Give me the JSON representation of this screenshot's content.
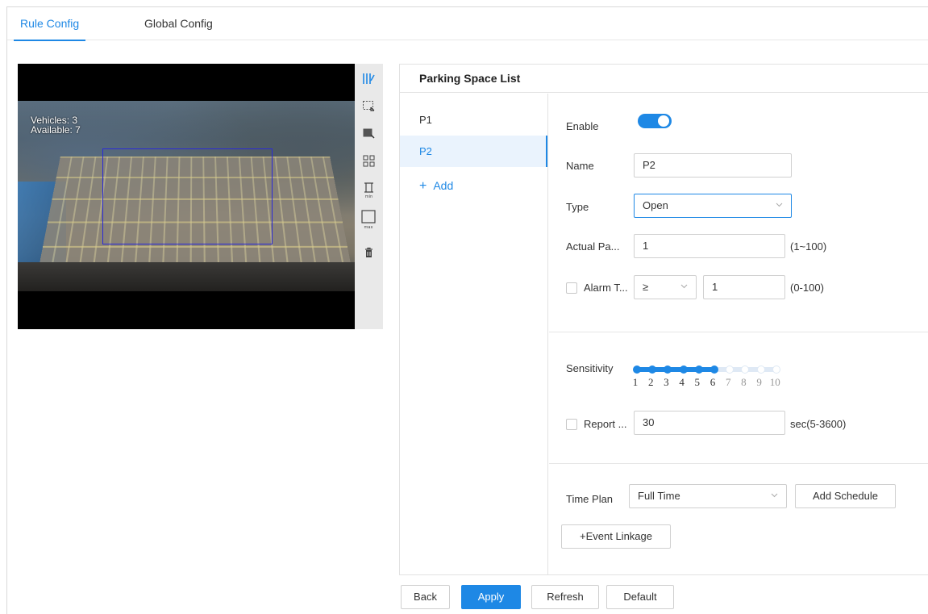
{
  "tabs": [
    {
      "label": "Rule Config",
      "active": true
    },
    {
      "label": "Global Config",
      "active": false
    }
  ],
  "video": {
    "osd_line1": "Vehicles: 3",
    "osd_line2": "Available: 7"
  },
  "toolbar": {
    "tools": [
      "draw-rule-icon",
      "select-area-icon",
      "clear-area-icon",
      "layout-grid-icon",
      "min-size-icon",
      "max-size-icon",
      "delete-icon"
    ],
    "min_label": "min",
    "max_label": "max"
  },
  "panel": {
    "title": "Parking Space List",
    "items": [
      {
        "label": "P1",
        "active": false
      },
      {
        "label": "P2",
        "active": true
      }
    ],
    "add_label": "Add"
  },
  "form": {
    "enable_label": "Enable",
    "enable_on": true,
    "name_label": "Name",
    "name_value": "P2",
    "type_label": "Type",
    "type_value": "Open",
    "actual_label": "Actual Pa...",
    "actual_value": "1",
    "actual_range": "(1~100)",
    "alarm_label": "Alarm T...",
    "alarm_operator": "≥",
    "alarm_value": "1",
    "alarm_range": "(0-100)",
    "alarm_checked": false,
    "sensitivity_label": "Sensitivity",
    "sensitivity_value": 6,
    "sensitivity_max": 10,
    "sensitivity_ticks": [
      "1",
      "2",
      "3",
      "4",
      "5",
      "6",
      "7",
      "8",
      "9",
      "10"
    ],
    "report_label": "Report ...",
    "report_value": "30",
    "report_range": "sec(5-3600)",
    "report_checked": false,
    "time_plan_label": "Time Plan",
    "time_plan_value": "Full Time",
    "add_schedule_label": "Add Schedule",
    "event_linkage_label": "+Event Linkage"
  },
  "footer": {
    "back": "Back",
    "apply": "Apply",
    "refresh": "Refresh",
    "default": "Default"
  },
  "colors": {
    "accent": "#1e88e5",
    "slider_off": "#dfe9f5"
  }
}
